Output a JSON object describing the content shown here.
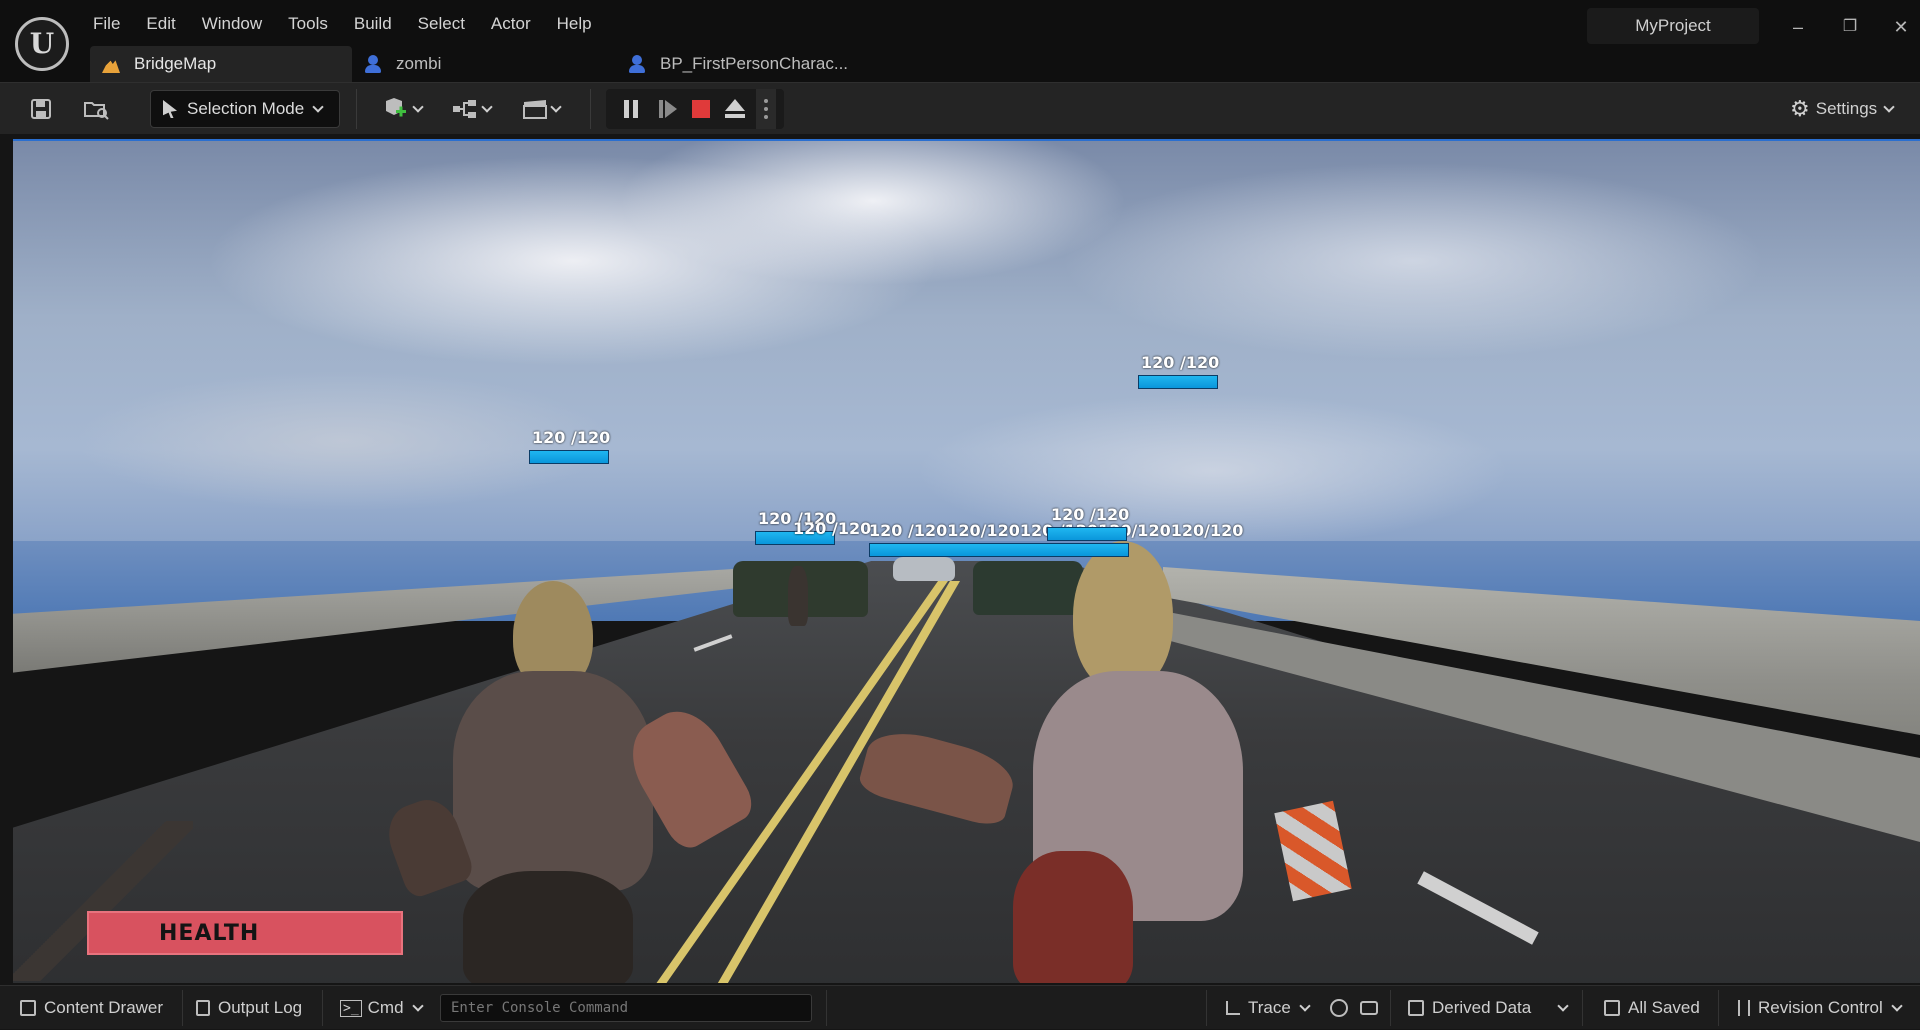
{
  "app": {
    "logo": "unreal-engine-logo",
    "project_name": "MyProject"
  },
  "menu": [
    "File",
    "Edit",
    "Window",
    "Tools",
    "Build",
    "Select",
    "Actor",
    "Help"
  ],
  "tabs": [
    {
      "label": "BridgeMap",
      "icon": "map-icon",
      "active": true
    },
    {
      "label": "zombi",
      "icon": "blueprint-icon",
      "active": false
    },
    {
      "label": "BP_FirstPersonCharac...",
      "icon": "blueprint-icon",
      "active": false
    }
  ],
  "toolbar": {
    "selection_mode": "Selection Mode",
    "settings": "Settings",
    "play_controls": [
      "pause",
      "step-frame",
      "stop",
      "eject",
      "more"
    ]
  },
  "viewport": {
    "enemy_health": [
      {
        "text": "120 /120",
        "value": 120,
        "max": 120
      },
      {
        "text": "120 /120",
        "value": 120,
        "max": 120
      },
      {
        "text": "120 /120",
        "value": 120,
        "max": 120
      },
      {
        "text": "120 /120",
        "value": 120,
        "max": 120
      },
      {
        "text": "120 /120",
        "value": 120,
        "max": 120
      }
    ],
    "crowded_label_text": "120 /120120/120120 /120120/120120/120",
    "player_health_label": "HEALTH"
  },
  "statusbar": {
    "content_drawer": "Content Drawer",
    "output_log": "Output Log",
    "cmd": "Cmd",
    "console_placeholder": "Enter Console Command",
    "trace": "Trace",
    "derived_data": "Derived Data",
    "all_saved": "All Saved",
    "revision_control": "Revision Control"
  },
  "colors": {
    "accent": "#2a6fd0",
    "health_panel": "#d8525f",
    "enemy_bar": "#0a96db",
    "stop": "#e03a3a"
  }
}
